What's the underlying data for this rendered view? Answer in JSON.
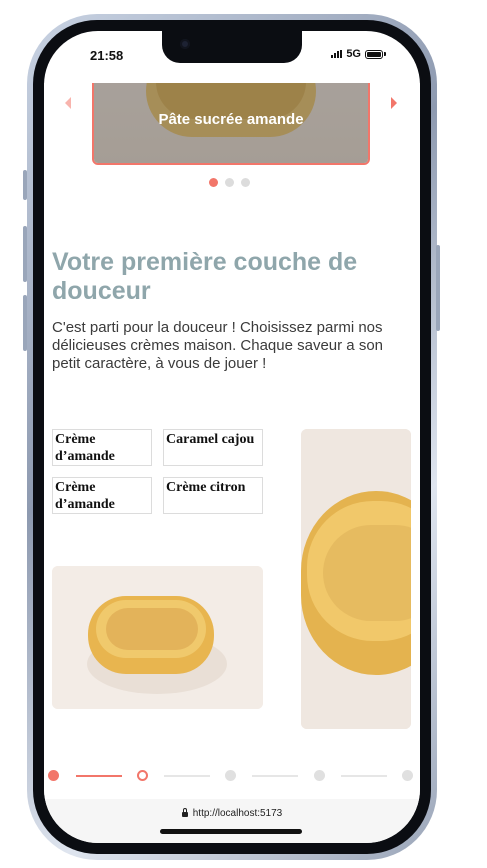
{
  "status_bar": {
    "time": "21:58",
    "network": "5G"
  },
  "carousel": {
    "caption": "Pâte sucrée amande",
    "slide_count": 3,
    "active_index": 0,
    "prev_icon": "chevron-left-icon",
    "next_icon": "chevron-right-icon"
  },
  "section": {
    "title": "Votre première couche de douceur",
    "description": "C'est parti pour la douceur ! Choisissez parmi nos délicieuses crèmes maison. Chaque saveur a son petit caractère, à vous de jouer !"
  },
  "options": [
    {
      "label": "Crème d’amande"
    },
    {
      "label": "Caramel cajou"
    },
    {
      "label": "Crème d’amande"
    },
    {
      "label": "Crème citron"
    }
  ],
  "stepper": {
    "current_step": 1,
    "total_visible": 5
  },
  "browser": {
    "url": "http://localhost:5173"
  },
  "colors": {
    "accent": "#f2766a",
    "title": "#8fa6ab",
    "text": "#3b3b3b"
  }
}
